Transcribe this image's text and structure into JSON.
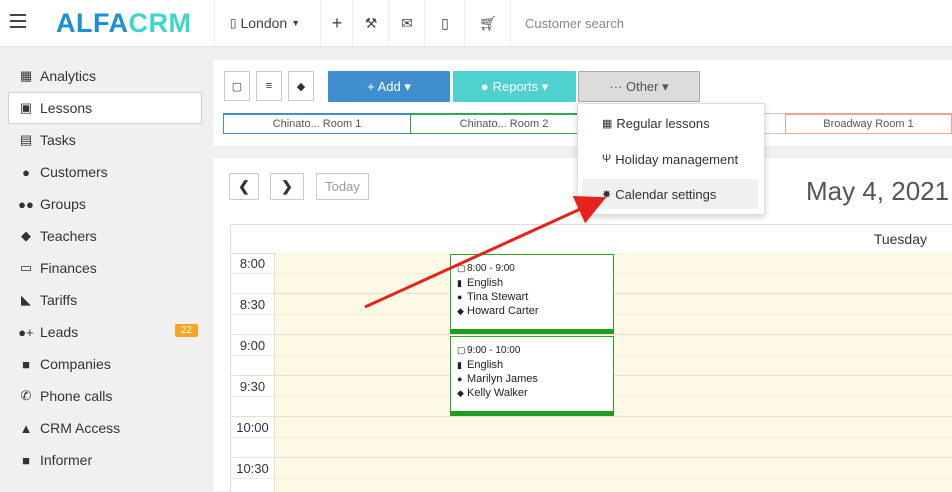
{
  "header": {
    "logo_left": "ALFA",
    "logo_right": "CRM",
    "branch": "London",
    "search_placeholder": "Customer search"
  },
  "sidebar": {
    "items": [
      {
        "label": "Analytics",
        "icon": "analytics-icon",
        "glyph": "▦"
      },
      {
        "label": "Lessons",
        "icon": "calendar-icon",
        "glyph": "▣",
        "active": true
      },
      {
        "label": "Tasks",
        "icon": "clipboard-icon",
        "glyph": "▤"
      },
      {
        "label": "Customers",
        "icon": "user-icon",
        "glyph": "●"
      },
      {
        "label": "Groups",
        "icon": "users-icon",
        "glyph": "●●"
      },
      {
        "label": "Teachers",
        "icon": "graduation-cap-icon",
        "glyph": "◆"
      },
      {
        "label": "Finances",
        "icon": "money-icon",
        "glyph": "▭"
      },
      {
        "label": "Tariffs",
        "icon": "tag-icon",
        "glyph": "◣"
      },
      {
        "label": "Leads",
        "icon": "user-plus-icon",
        "glyph": "●+",
        "badge": "22"
      },
      {
        "label": "Companies",
        "icon": "briefcase-icon",
        "glyph": "■"
      },
      {
        "label": "Phone calls",
        "icon": "phone-icon",
        "glyph": "✆"
      },
      {
        "label": "CRM Access",
        "icon": "lock-icon",
        "glyph": "▲"
      },
      {
        "label": "Informer",
        "icon": "newspaper-icon",
        "glyph": "■"
      }
    ]
  },
  "toolbar": {
    "add_label": "+ Add ▾",
    "reports_label": "Reports ▾",
    "other_label": "··· Other ▾",
    "colors": {
      "add": "#3e8ed0",
      "reports": "#4fd1cf",
      "other": "#dcdcdc"
    }
  },
  "rooms": [
    "Chinato... Room 1",
    "Chinato... Room 2",
    "Broadway Room 1"
  ],
  "dropdown": {
    "items": [
      "Regular lessons",
      "Holiday management",
      "Calendar settings"
    ]
  },
  "calendar": {
    "today_label": "Today",
    "date_title": "May 4, 2021",
    "day_name": "Tuesday",
    "times": [
      "8:00",
      "8:30",
      "9:00",
      "9:30",
      "10:00",
      "10:30"
    ],
    "events": [
      {
        "time": "8:00 - 9:00",
        "subject": "English",
        "customer": "Tina Stewart",
        "teacher": "Howard Carter"
      },
      {
        "time": "9:00 - 10:00",
        "subject": "English",
        "customer": "Marilyn James",
        "teacher": "Kelly Walker"
      }
    ]
  },
  "annotation": {
    "arrow_color": "#e8221b"
  }
}
